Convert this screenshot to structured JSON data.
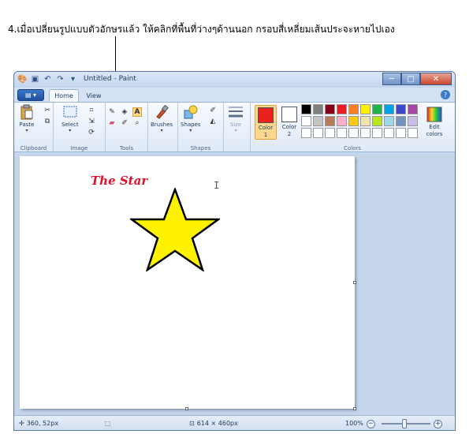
{
  "caption": "4.เมื่อเปลี่ยนรูปแบบตัวอักษรแล้ว ให้คลิกที่พื้นที่ว่างๆด้านนอก กรอบสี่เหลี่ยมเส้นประจะหายไปเอง",
  "window": {
    "title": "Untitled - Paint"
  },
  "tabs": {
    "home": "Home",
    "view": "View"
  },
  "ribbon": {
    "clipboard": {
      "label": "Clipboard",
      "paste": "Paste"
    },
    "image": {
      "label": "Image",
      "select": "Select"
    },
    "tools": {
      "label": "Tools"
    },
    "brushes": {
      "label": "Brushes"
    },
    "shapes": {
      "label": "Shapes",
      "shapes_btn": "Shapes"
    },
    "size": {
      "label": "Size"
    },
    "colors": {
      "label": "Colors",
      "color1": "Color\n1",
      "color2": "Color\n2",
      "edit": "Edit\ncolors"
    }
  },
  "colors": {
    "color1": "#e8211c",
    "color2": "#ffffff",
    "palette": [
      "#000000",
      "#7f7f7f",
      "#880015",
      "#ed1c24",
      "#ff7f27",
      "#fff200",
      "#22b14c",
      "#00a2e8",
      "#3f48cc",
      "#a349a4",
      "#ffffff",
      "#c3c3c3",
      "#b97a57",
      "#ffaec9",
      "#ffc90e",
      "#efe4b0",
      "#b5e61d",
      "#99d9ea",
      "#7092be",
      "#c8bfe7",
      "#ffffff",
      "#ffffff",
      "#ffffff",
      "#ffffff",
      "#ffffff",
      "#ffffff",
      "#ffffff",
      "#ffffff",
      "#ffffff",
      "#ffffff"
    ],
    "star_fill": "#fff200"
  },
  "canvas": {
    "text": "The Star"
  },
  "status": {
    "cursor_pos": "360, 52px",
    "canvas_size": "614 × 460px",
    "zoom": "100%"
  }
}
